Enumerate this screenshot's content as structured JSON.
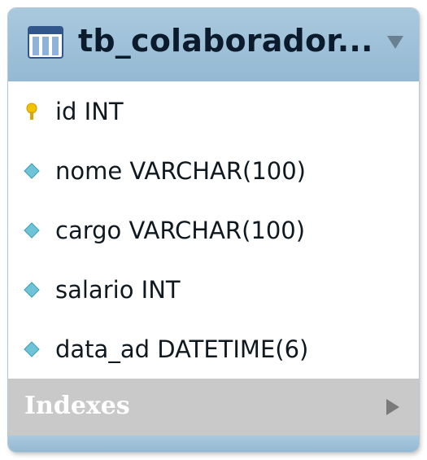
{
  "table": {
    "title": "tb_colaborador...",
    "columns": [
      {
        "label": "id INT",
        "icon": "primary-key-icon"
      },
      {
        "label": "nome VARCHAR(100)",
        "icon": "column-diamond-icon"
      },
      {
        "label": "cargo VARCHAR(100)",
        "icon": "column-diamond-icon"
      },
      {
        "label": "salario INT",
        "icon": "column-diamond-icon"
      },
      {
        "label": "data_ad DATETIME(6)",
        "icon": "column-diamond-icon"
      }
    ],
    "indexes_label": "Indexes"
  },
  "colors": {
    "header": "#a9c9de",
    "key": "#f2c300",
    "diamond": "#6ec3d6",
    "indexes_bg": "#c9c9c9"
  }
}
